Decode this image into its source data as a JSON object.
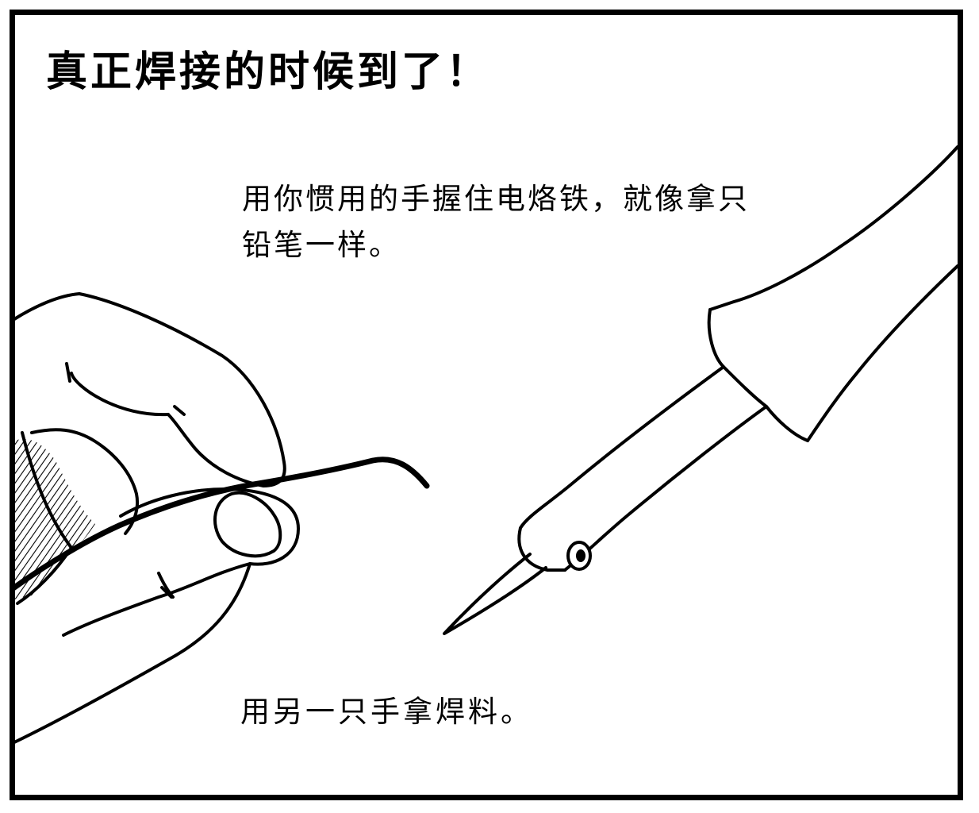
{
  "panel": {
    "title": "真正焊接的时候到了！",
    "caption_iron": "用你惯用的手握住电烙铁，就像拿只\n铅笔一样。",
    "caption_solder": "用另一只手拿焊料。"
  },
  "colors": {
    "ink": "#000000",
    "paper": "#ffffff"
  },
  "icons": [
    "hand-holding-solder-illustration",
    "soldering-iron-illustration"
  ]
}
